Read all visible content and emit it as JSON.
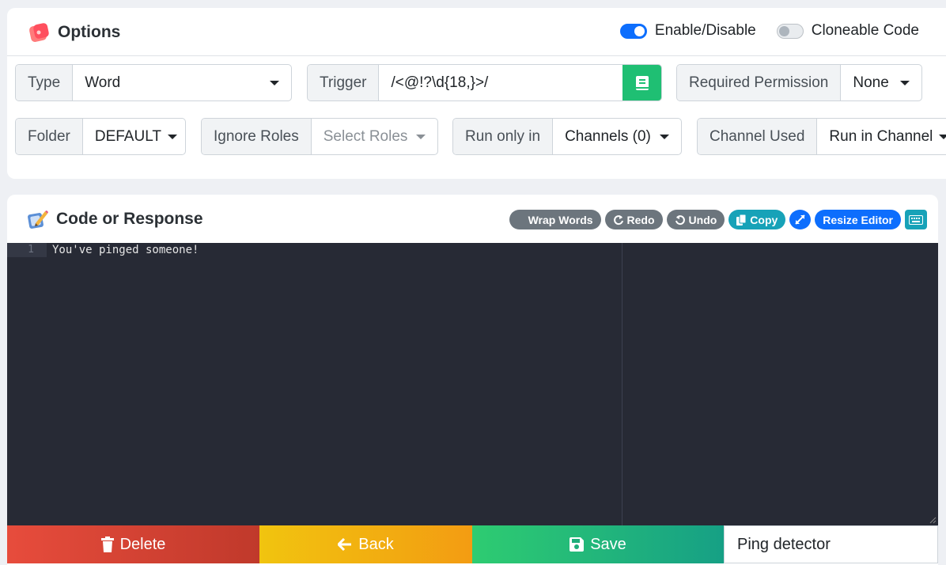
{
  "options": {
    "title": "Options",
    "enable_label": "Enable/Disable",
    "enable_on": true,
    "cloneable_label": "Cloneable Code",
    "cloneable_on": false,
    "type": {
      "label": "Type",
      "value": "Word"
    },
    "trigger": {
      "label": "Trigger",
      "value": "/<@!?\\d{18,}>/"
    },
    "required_permission": {
      "label": "Required Permission",
      "value": "None"
    },
    "folder": {
      "label": "Folder",
      "value": "DEFAULT"
    },
    "ignore_roles": {
      "label": "Ignore Roles",
      "placeholder": "Select Roles"
    },
    "run_only_in": {
      "label": "Run only in",
      "value": "Channels (0)"
    },
    "channel_used": {
      "label": "Channel Used",
      "value": "Run in Channel"
    }
  },
  "code": {
    "title": "Code or Response",
    "toolbar": {
      "wrap": "Wrap Words",
      "redo": "Redo",
      "undo": "Undo",
      "copy": "Copy",
      "resize": "Resize Editor"
    },
    "lines": [
      {
        "number": "1",
        "text": "You've pinged someone!"
      }
    ]
  },
  "footer": {
    "delete": "Delete",
    "back": "Back",
    "save": "Save",
    "name_value": "Ping detector"
  },
  "colors": {
    "accent": "#0d6efd",
    "success": "#1fbf73",
    "editor_bg": "#272a35"
  }
}
